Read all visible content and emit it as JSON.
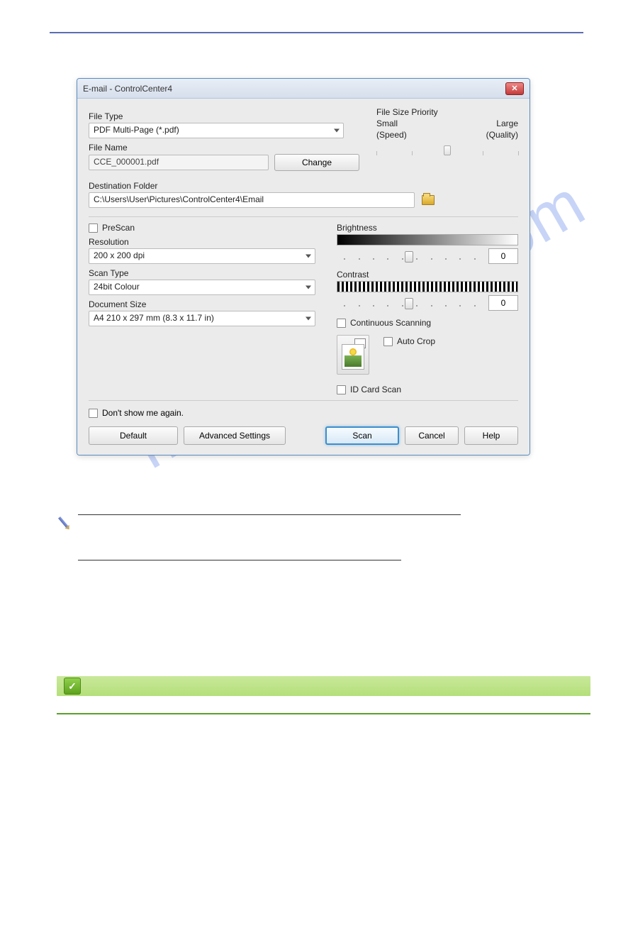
{
  "dialog": {
    "title": "E-mail - ControlCenter4",
    "close_symbol": "✕",
    "file_type_label": "File Type",
    "file_type_value": "PDF Multi-Page (*.pdf)",
    "file_name_label": "File Name",
    "file_name_value": "CCE_000001.pdf",
    "change_label": "Change",
    "dest_folder_label": "Destination Folder",
    "dest_folder_value": "C:\\Users\\User\\Pictures\\ControlCenter4\\Email",
    "fsp": {
      "label": "File Size Priority",
      "small": "Small",
      "large": "Large",
      "speed": "(Speed)",
      "quality": "(Quality)"
    },
    "prescan_label": "PreScan",
    "resolution_label": "Resolution",
    "resolution_value": "200 x 200 dpi",
    "scan_type_label": "Scan Type",
    "scan_type_value": "24bit Colour",
    "doc_size_label": "Document Size",
    "doc_size_value": "A4 210 x 297 mm (8.3 x 11.7 in)",
    "brightness_label": "Brightness",
    "brightness_value": "0",
    "contrast_label": "Contrast",
    "contrast_value": "0",
    "continuous_label": "Continuous Scanning",
    "auto_crop_label": "Auto Crop",
    "id_card_label": "ID Card Scan",
    "dont_show_label": "Don't show me again.",
    "buttons": {
      "default": "Default",
      "advanced": "Advanced Settings",
      "scan": "Scan",
      "cancel": "Cancel",
      "help": "Help"
    }
  },
  "watermark": "manualslive.com",
  "success_check": "✓"
}
